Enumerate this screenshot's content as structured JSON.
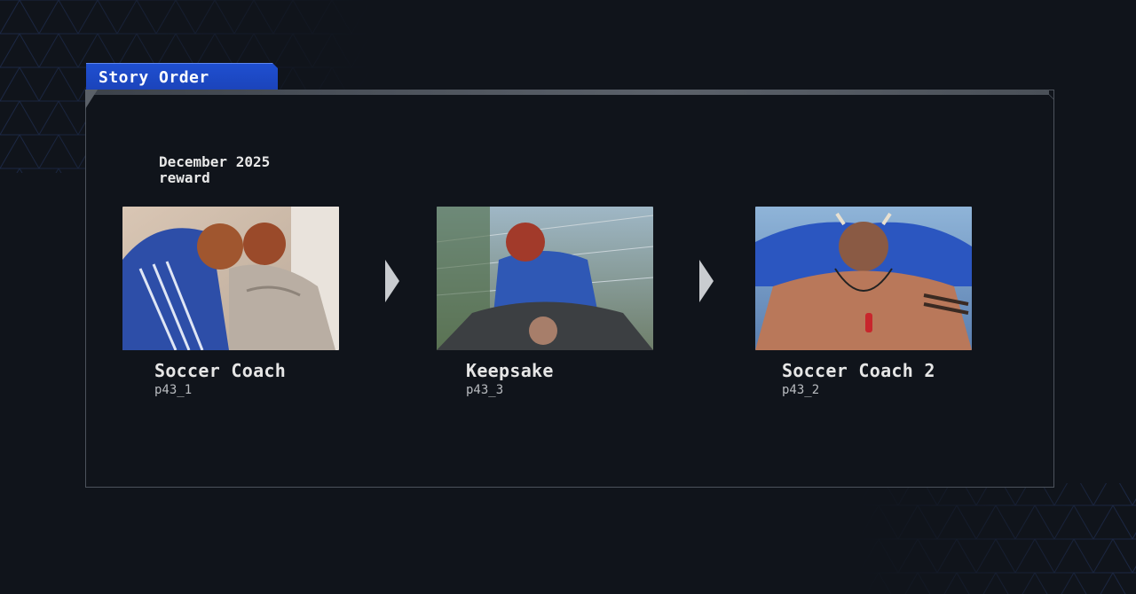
{
  "panel": {
    "title": "Story Order",
    "reward_label": "December 2025\nreward"
  },
  "stories": [
    {
      "title": "Soccer Coach",
      "code": "p43_1",
      "image_icon": "story-illustration"
    },
    {
      "title": "Keepsake",
      "code": "p43_3",
      "image_icon": "story-illustration"
    },
    {
      "title": "Soccer Coach 2",
      "code": "p43_2",
      "image_icon": "story-illustration"
    }
  ],
  "colors": {
    "accent": "#1f4fd0",
    "background": "#10141b",
    "border": "#4c535c",
    "arrow": "#c9ccd0"
  }
}
